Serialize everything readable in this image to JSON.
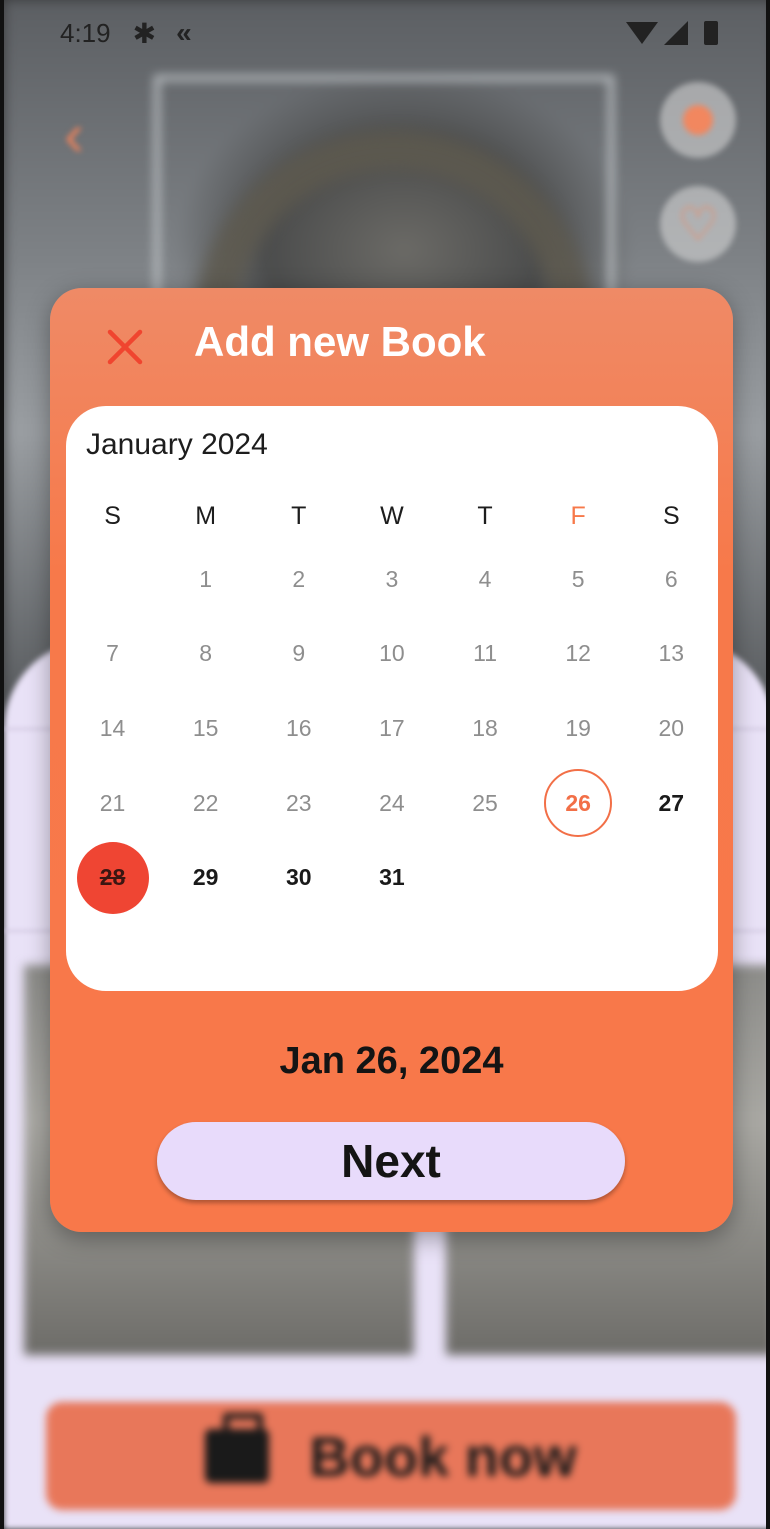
{
  "status_bar": {
    "time": "4:19",
    "icons": [
      "gear-icon",
      "app-notification-icon",
      "wifi-icon",
      "signal-icon",
      "battery-icon"
    ]
  },
  "background": {
    "book_now_label": "Book now",
    "icons": [
      "back-arrow-icon",
      "profile-icon",
      "heart-icon",
      "briefcase-icon"
    ]
  },
  "modal": {
    "title": "Add new Book",
    "close_icon": "close-icon",
    "month_label": "January 2024",
    "weekdays": [
      "S",
      "M",
      "T",
      "W",
      "T",
      "F",
      "S"
    ],
    "highlight_weekday_index": 5,
    "first_day_offset": 1,
    "days_in_month": 31,
    "first_available_day": 26,
    "selected_day": 26,
    "booked_days": [
      28
    ],
    "selected_date_text": "Jan 26, 2024",
    "next_label": "Next"
  },
  "colors": {
    "accent": "#F7794A",
    "selected_ring": "#F26F47",
    "booked": "#EF4533",
    "button_bg": "#E8DBFB"
  }
}
